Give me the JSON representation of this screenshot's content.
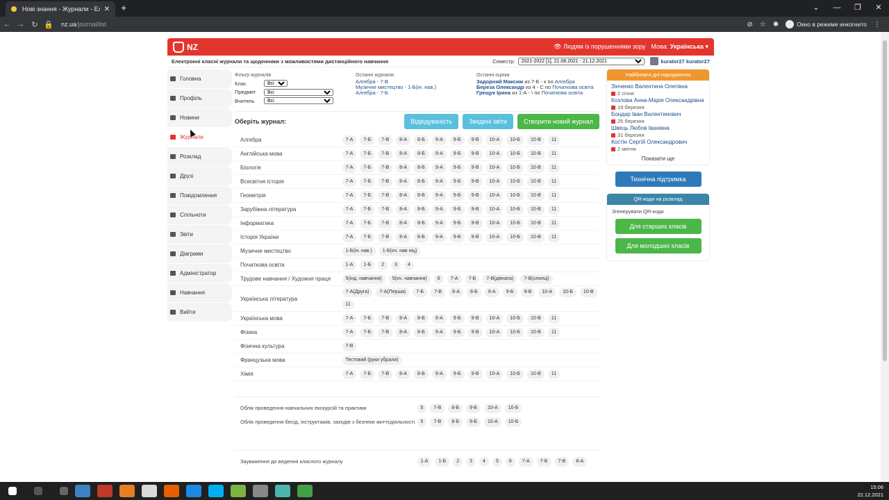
{
  "browser": {
    "tab_title": "Нові знання - Журнали - Електр",
    "url_host": "nz.ua",
    "url_path": "/journal/list",
    "incognito_label": "Окно в режиме инкогнито"
  },
  "header": {
    "logo": "NZ",
    "accessibility": "Людям із порушеннями зору",
    "lang_label": "Мова:",
    "lang_value": "Українська"
  },
  "subheader": {
    "tagline": "Електронні класні журнали та щоденники з можливостями дистанційного навчання",
    "semester_label": "Семестр:",
    "semester_value": "2021-2022 [1], 21.08.2021 - 21.12.2021",
    "user": "kurator27 kurator27"
  },
  "sidebar": [
    {
      "label": "Головна"
    },
    {
      "label": "Профіль"
    },
    {
      "label": "Новини"
    },
    {
      "label": "Журнали"
    },
    {
      "label": "Розклад"
    },
    {
      "label": "Друзі"
    },
    {
      "label": "Повідомлення"
    },
    {
      "label": "Спільноти"
    },
    {
      "label": "Звіти"
    },
    {
      "label": "Діаграми"
    },
    {
      "label": "Адміністратор"
    },
    {
      "label": "Навчання"
    },
    {
      "label": "Вийти"
    }
  ],
  "filters": {
    "title": "Фільтр журналів",
    "class_label": "Клас",
    "class_value": "Всі",
    "subject_label": "Предмет",
    "subject_value": "Всі",
    "teacher_label": "Вчитель",
    "teacher_value": "Всі",
    "recent_title": "Останні журнали",
    "recent": [
      "Алгебра - 7-В",
      "Музичне мистецтво - 1-Б(ін. нав.)",
      "Алгебра - 7-Б"
    ],
    "grades_title": "Останні оцінки",
    "grades": [
      {
        "name": "Задорний Максим",
        "text": " из 7-Б - к по ",
        "subject": "Алгебра"
      },
      {
        "name": "Береза Олександр",
        "text": " из 4 - С по ",
        "subject": "Початкова освіта"
      },
      {
        "name": "Грещук Ірина",
        "text": " из 1-А - \\ по ",
        "subject": "Початкова освіта"
      }
    ]
  },
  "choose": {
    "title": "Оберіть журнал:",
    "attendance": "Відвідуваність",
    "summary": "Зведені звіти",
    "create": "Створити новий журнал"
  },
  "subjects": [
    {
      "name": "Алгебра",
      "classes": [
        "7-А",
        "7-Б",
        "7-В",
        "8-А",
        "8-Б",
        "9-А",
        "9-Б",
        "9-В",
        "10-А",
        "10-Б",
        "10-В",
        "11"
      ]
    },
    {
      "name": "Англійська мова",
      "classes": [
        "7-А",
        "7-Б",
        "7-В",
        "8-А",
        "8-Б",
        "9-А",
        "9-Б",
        "9-В",
        "10-А",
        "10-Б",
        "10-В",
        "11"
      ]
    },
    {
      "name": "Біологія",
      "classes": [
        "7-А",
        "7-Б",
        "7-В",
        "8-А",
        "8-Б",
        "9-А",
        "9-Б",
        "9-В",
        "10-А",
        "10-Б",
        "10-В",
        "11"
      ]
    },
    {
      "name": "Всесвітня історія",
      "classes": [
        "7-А",
        "7-Б",
        "7-В",
        "8-А",
        "8-Б",
        "9-А",
        "9-Б",
        "9-В",
        "10-А",
        "10-Б",
        "10-В",
        "11"
      ]
    },
    {
      "name": "Геометрія",
      "classes": [
        "7-А",
        "7-Б",
        "7-В",
        "8-А",
        "8-Б",
        "9-А",
        "9-Б",
        "9-В",
        "10-А",
        "10-Б",
        "10-В",
        "11"
      ]
    },
    {
      "name": "Зарубіжна література",
      "classes": [
        "7-А",
        "7-Б",
        "7-В",
        "8-А",
        "8-Б",
        "9-А",
        "9-Б",
        "9-В",
        "10-А",
        "10-Б",
        "10-В",
        "11"
      ]
    },
    {
      "name": "Інформатика",
      "classes": [
        "7-А",
        "7-Б",
        "7-В",
        "8-А",
        "8-Б",
        "9-А",
        "9-Б",
        "9-В",
        "10-А",
        "10-Б",
        "10-В",
        "11"
      ]
    },
    {
      "name": "Історія України",
      "classes": [
        "7-А",
        "7-Б",
        "7-В",
        "8-А",
        "8-Б",
        "9-А",
        "9-Б",
        "9-В",
        "10-А",
        "10-Б",
        "10-В",
        "11"
      ]
    },
    {
      "name": "Музичне мистецтво",
      "classes": [
        "1-Б(ін. нав.)",
        "1-Б(оч. нав ніц)"
      ]
    },
    {
      "name": "Початкова освіта",
      "classes": [
        "1-А",
        "1-Б",
        "2",
        "3",
        "4"
      ]
    },
    {
      "name": "Трудове навчання / Художня праця",
      "classes": [
        "5(інд. навчання)",
        "5(оч. навчання)",
        "6",
        "7-А",
        "7-Б",
        "7-В(дівчата)",
        "7-В(хлопці)"
      ]
    },
    {
      "name": "Українська література",
      "classes": [
        "7-А(Друга)",
        "7-А(Перша)",
        "7-Б",
        "7-В",
        "8-А",
        "8-Б",
        "9-А",
        "9-Б",
        "9-В",
        "10-А",
        "10-Б",
        "10-В",
        "11"
      ]
    },
    {
      "name": "Українська мова",
      "classes": [
        "7-А",
        "7-Б",
        "7-В",
        "8-А",
        "8-Б",
        "9-А",
        "9-Б",
        "9-В",
        "10-А",
        "10-Б",
        "10-В",
        "11"
      ]
    },
    {
      "name": "Фізика",
      "classes": [
        "7-А",
        "7-Б",
        "7-В",
        "8-А",
        "8-Б",
        "9-А",
        "9-Б",
        "9-В",
        "10-А",
        "10-Б",
        "10-В",
        "11"
      ]
    },
    {
      "name": "Фізична культура",
      "classes": [
        "7-В"
      ]
    },
    {
      "name": "Французька мова",
      "classes": [
        "Тестовий (руки убрали)"
      ]
    },
    {
      "name": "Хімія",
      "classes": [
        "7-А",
        "7-Б",
        "7-В",
        "8-А",
        "8-Б",
        "9-А",
        "9-Б",
        "9-В",
        "10-А",
        "10-Б",
        "10-В",
        "11"
      ]
    }
  ],
  "special": [
    {
      "name": "Облік проведення навчальних екскурсій та практики",
      "classes": [
        "5",
        "7-В",
        "8-Б",
        "9-Б",
        "10-А",
        "10-Б"
      ]
    },
    {
      "name": "Облік проведення бесід, інструктажів, заходів з безпеки життєдіяльності",
      "classes": [
        "5",
        "7-В",
        "8-Б",
        "9-Б",
        "10-А",
        "10-Б"
      ]
    }
  ],
  "remarks": {
    "name": "Зауваження до ведення класного журналу",
    "classes": [
      "1-А",
      "1-Б",
      "2",
      "3",
      "4",
      "5",
      "6",
      "7-А",
      "7-Б",
      "7-В",
      "8-А"
    ]
  },
  "birthdays": {
    "title": "Найближчі дні народження",
    "people": [
      {
        "name": "Зінченко Валентина Олегівна",
        "date": "2 січня"
      },
      {
        "name": "Козлова Анна-Марія Олександрівна",
        "date": "19 березня"
      },
      {
        "name": "Бондар Іван Валентинович",
        "date": "25 березня"
      },
      {
        "name": "Швець Любов Іванівна",
        "date": "31 березня"
      },
      {
        "name": "Костін Сергій Олександрович",
        "date": "2 квітня"
      }
    ],
    "more": "Показати ще"
  },
  "support": "Технічна підтримка",
  "qr": {
    "title": "QR-коди на розклад",
    "text": "Згенерувати QR-коди",
    "senior": "Для старших класів",
    "junior": "Для молодших класів"
  },
  "taskbar": {
    "time": "15:06",
    "date": "22.12.2021"
  }
}
